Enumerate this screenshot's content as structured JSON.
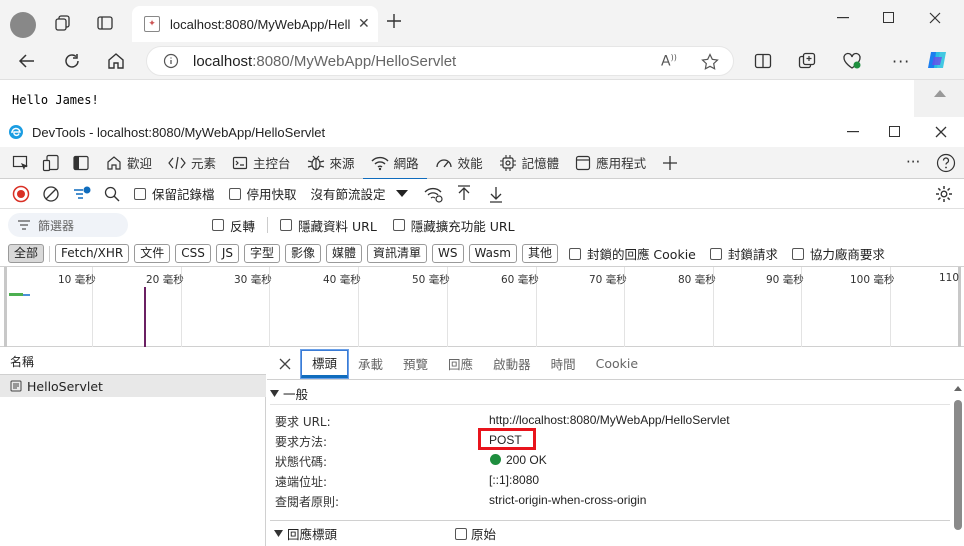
{
  "browser": {
    "tab_title": "localhost:8080/MyWebApp/Hellc",
    "url_host": "localhost",
    "url_rest": ":8080/MyWebApp/HelloServlet",
    "page_text": "Hello James!"
  },
  "devtools": {
    "window_title": "DevTools - localhost:8080/MyWebApp/HelloServlet",
    "tool_tabs": [
      {
        "label": "歡迎",
        "icon": "home-icon"
      },
      {
        "label": "元素",
        "icon": "code-icon"
      },
      {
        "label": "主控台",
        "icon": "console-icon"
      },
      {
        "label": "來源",
        "icon": "bug-icon"
      },
      {
        "label": "網路",
        "icon": "wifi-icon",
        "active": true
      },
      {
        "label": "效能",
        "icon": "gauge-icon"
      },
      {
        "label": "記憶體",
        "icon": "chip-icon"
      },
      {
        "label": "應用程式",
        "icon": "window-icon"
      }
    ],
    "net_toolbar": {
      "preserve_log": "保留記錄檔",
      "disable_cache": "停用快取",
      "throttle": "沒有節流設定"
    },
    "filter": {
      "placeholder": "篩選器",
      "invert": "反轉",
      "hide_data_urls": "隱藏資料 URL",
      "hide_ext_urls": "隱藏擴充功能 URL"
    },
    "type_filters": [
      "全部",
      "Fetch/XHR",
      "文件",
      "CSS",
      "JS",
      "字型",
      "影像",
      "媒體",
      "資訊清單",
      "WS",
      "Wasm",
      "其他"
    ],
    "extra_filters": {
      "blocked_cookies": "封鎖的回應 Cookie",
      "blocked_requests": "封鎖請求",
      "third_party": "協力廠商要求"
    },
    "timeline_ticks": [
      "10 毫秒",
      "20 毫秒",
      "30 毫秒",
      "40 毫秒",
      "50 毫秒",
      "60 毫秒",
      "70 毫秒",
      "80 毫秒",
      "90 毫秒",
      "100 毫秒",
      "110"
    ],
    "request_list": {
      "header": "名稱",
      "rows": [
        "HelloServlet"
      ]
    },
    "detail_tabs": [
      "標頭",
      "承載",
      "預覽",
      "回應",
      "啟動器",
      "時間",
      "Cookie"
    ],
    "general": {
      "title": "一般",
      "rows": [
        {
          "key": "要求 URL:",
          "value": "http://localhost:8080/MyWebApp/HelloServlet"
        },
        {
          "key": "要求方法:",
          "value": "POST"
        },
        {
          "key": "狀態代碼:",
          "value": "200 OK"
        },
        {
          "key": "遠端位址:",
          "value": "[::1]:8080"
        },
        {
          "key": "查閱者原則:",
          "value": "strict-origin-when-cross-origin"
        }
      ]
    },
    "response_headers": {
      "title": "回應標頭",
      "raw_label": "原始"
    },
    "colors": {
      "accent": "#0f6cbd",
      "highlight": "#e8141c",
      "status_ok": "#1e8e3e",
      "record": "#d93025"
    }
  }
}
